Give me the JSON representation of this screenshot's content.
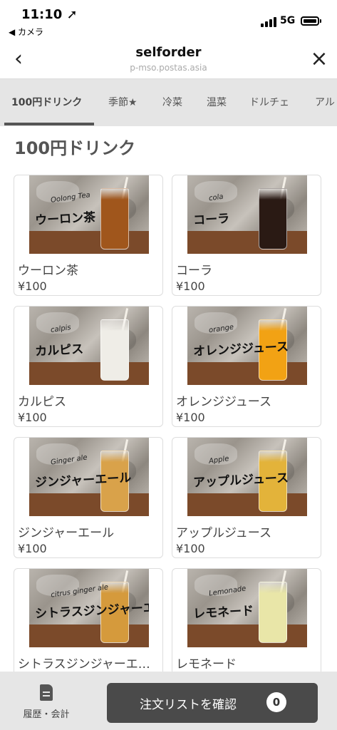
{
  "status_bar": {
    "time": "11:10 ➚",
    "back_app": "◀ カメラ",
    "network": "5G"
  },
  "header": {
    "title": "selforder",
    "url": "p-mso.postas.asia",
    "back_icon": "chevron-left-icon",
    "close_icon": "close-icon"
  },
  "tabs": [
    "100円ドリンク",
    "季節★",
    "冷菜",
    "温菜",
    "ドルチェ",
    "アル"
  ],
  "active_tab": 0,
  "section_title": "100円ドリンク",
  "menu_items": [
    {
      "name": "ウーロン茶",
      "price": "¥100",
      "photo_script": "ウーロン茶",
      "photo_english": "Oolong Tea",
      "drink_color": "#a0561c"
    },
    {
      "name": "コーラ",
      "price": "¥100",
      "photo_script": "コーラ",
      "photo_english": "cola",
      "drink_color": "#2a1a14"
    },
    {
      "name": "カルピス",
      "price": "¥100",
      "photo_script": "カルピス",
      "photo_english": "calpis",
      "drink_color": "#efede7"
    },
    {
      "name": "オレンジジュース",
      "price": "¥100",
      "photo_script": "オレンジジュース",
      "photo_english": "orange",
      "drink_color": "#f2a214"
    },
    {
      "name": "ジンジャーエール",
      "price": "¥100",
      "photo_script": "ジンジャーエール",
      "photo_english": "Ginger ale",
      "drink_color": "#d9a24a"
    },
    {
      "name": "アップルジュース",
      "price": "¥100",
      "photo_script": "アップルジュース",
      "photo_english": "Apple",
      "drink_color": "#e3b33a"
    },
    {
      "name": "シトラスジンジャーエ…",
      "price": "",
      "photo_script": "シトラスジンジャーエール",
      "photo_english": "citrus ginger ale",
      "drink_color": "#d59a3c"
    },
    {
      "name": "レモネード",
      "price": "",
      "photo_script": "レモネード",
      "photo_english": "Lemonade",
      "drink_color": "#e9e6a8"
    }
  ],
  "footer": {
    "history_label": "履歴・会計",
    "order_button_label": "注文リストを確認",
    "order_count": "0"
  }
}
